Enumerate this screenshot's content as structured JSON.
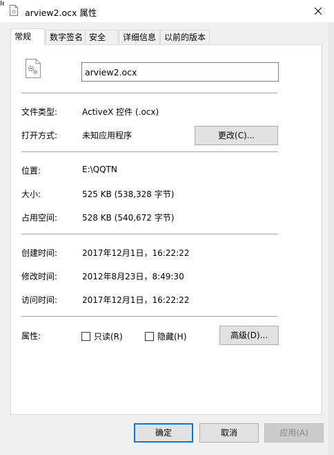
{
  "window": {
    "title": "arview2.ocx 属性",
    "behind_text": "Ie",
    "close_icon": "close-icon"
  },
  "tabs": [
    {
      "label": "常规",
      "active": true
    },
    {
      "label": "数字签名",
      "active": false
    },
    {
      "label": "安全",
      "active": false
    },
    {
      "label": "详细信息",
      "active": false
    },
    {
      "label": "以前的版本",
      "active": false
    }
  ],
  "general": {
    "file_icon": "settings-file-icon",
    "file_name": "arview2.ocx",
    "file_type_label": "文件类型:",
    "file_type_value": "ActiveX 控件 (.ocx)",
    "opens_with_label": "打开方式:",
    "opens_with_value": "未知应用程序",
    "change_button": "更改(C)...",
    "location_label": "位置:",
    "location_value": "E:\\QQTN",
    "size_label": "大小:",
    "size_value": "525 KB (538,328 字节)",
    "size_on_disk_label": "占用空间:",
    "size_on_disk_value": "528 KB (540,672 字节)",
    "created_label": "创建时间:",
    "created_value": "2017年12月1日，16:22:22",
    "modified_label": "修改时间:",
    "modified_value": "2012年8月23日，8:49:30",
    "accessed_label": "访问时间:",
    "accessed_value": "2017年12月1日，16:22:22",
    "attributes_label": "属性:",
    "readonly_label": "只读(R)",
    "readonly_checked": false,
    "hidden_label": "隐藏(H)",
    "hidden_checked": false,
    "advanced_button": "高级(D)..."
  },
  "footer": {
    "ok": "确定",
    "cancel": "取消",
    "apply": "应用(A)"
  },
  "colors": {
    "default_button_border": "#0078d7",
    "disabled_text": "#838383"
  }
}
